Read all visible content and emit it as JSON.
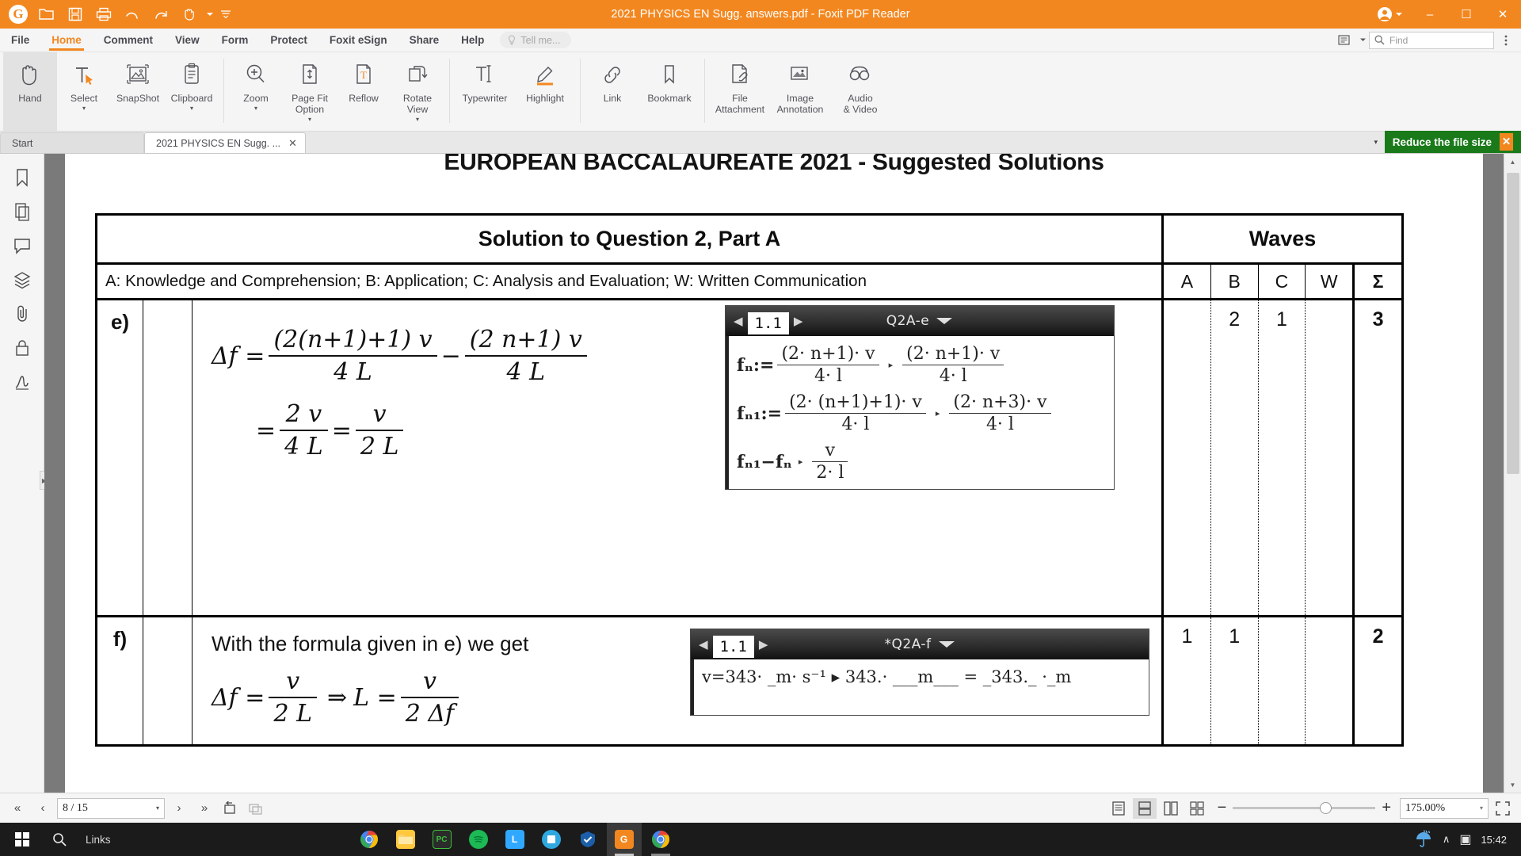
{
  "window": {
    "title": "2021 PHYSICS EN Sugg. answers.pdf - Foxit PDF Reader",
    "brand_color": "#f3871f",
    "logo_glyph": "G",
    "quick_access": [
      {
        "name": "open-icon",
        "tooltip": "Open"
      },
      {
        "name": "save-icon",
        "tooltip": "Save"
      },
      {
        "name": "print-icon",
        "tooltip": "Print"
      },
      {
        "name": "undo-icon",
        "tooltip": "Undo"
      },
      {
        "name": "redo-icon",
        "tooltip": "Redo"
      },
      {
        "name": "hand-tool-icon",
        "tooltip": "Hand Tool"
      },
      {
        "name": "customize-icon",
        "tooltip": "Customize"
      }
    ],
    "controls": {
      "account_label": "",
      "minimize": "–",
      "maximize": "☐",
      "close": "✕"
    }
  },
  "menubar": {
    "items": [
      {
        "label": "File",
        "active": false
      },
      {
        "label": "Home",
        "active": true
      },
      {
        "label": "Comment",
        "active": false
      },
      {
        "label": "View",
        "active": false
      },
      {
        "label": "Form",
        "active": false
      },
      {
        "label": "Protect",
        "active": false
      },
      {
        "label": "Foxit eSign",
        "active": false
      },
      {
        "label": "Share",
        "active": false
      },
      {
        "label": "Help",
        "active": false
      }
    ],
    "tell_me": "Tell me...",
    "find_placeholder": "Find"
  },
  "ribbon": {
    "groups": [
      {
        "items": [
          {
            "label": "Hand",
            "label2": "",
            "icon": "hand-icon",
            "selected": true,
            "caret": false
          },
          {
            "label": "Select",
            "label2": "",
            "icon": "select-text-icon",
            "selected": false,
            "caret": true
          },
          {
            "label": "SnapShot",
            "label2": "",
            "icon": "snapshot-icon",
            "selected": false,
            "caret": false
          },
          {
            "label": "Clipboard",
            "label2": "",
            "icon": "clipboard-icon",
            "selected": false,
            "caret": true
          }
        ]
      },
      {
        "items": [
          {
            "label": "Zoom",
            "label2": "",
            "icon": "zoom-in-icon",
            "selected": false,
            "caret": true
          },
          {
            "label": "Page Fit",
            "label2": "Option",
            "icon": "page-fit-icon",
            "selected": false,
            "caret": true
          },
          {
            "label": "Reflow",
            "label2": "",
            "icon": "reflow-icon",
            "selected": false,
            "caret": false
          },
          {
            "label": "Rotate",
            "label2": "View",
            "icon": "rotate-view-icon",
            "selected": false,
            "caret": true
          }
        ]
      },
      {
        "items": [
          {
            "label": "Typewriter",
            "label2": "",
            "icon": "typewriter-icon",
            "selected": false,
            "caret": false
          },
          {
            "label": "Highlight",
            "label2": "",
            "icon": "highlight-icon",
            "selected": false,
            "caret": false
          }
        ]
      },
      {
        "items": [
          {
            "label": "Link",
            "label2": "",
            "icon": "link-icon",
            "selected": false,
            "caret": false
          },
          {
            "label": "Bookmark",
            "label2": "",
            "icon": "bookmark-icon",
            "selected": false,
            "caret": false
          }
        ]
      },
      {
        "items": [
          {
            "label": "File",
            "label2": "Attachment",
            "icon": "file-attachment-icon",
            "selected": false,
            "caret": false
          },
          {
            "label": "Image",
            "label2": "Annotation",
            "icon": "image-annotation-icon",
            "selected": false,
            "caret": false
          },
          {
            "label": "Audio",
            "label2": "& Video",
            "icon": "audio-video-icon",
            "selected": false,
            "caret": false
          }
        ]
      }
    ]
  },
  "tabstrip": {
    "tabs": [
      {
        "label": "Start",
        "active": false,
        "closable": false
      },
      {
        "label": "2021 PHYSICS EN Sugg. ...",
        "active": true,
        "closable": true
      }
    ],
    "close_glyph": "✕",
    "banner": {
      "label": "Reduce the file size",
      "close_glyph": "✕",
      "color": "#1a7a1a"
    }
  },
  "leftbar": {
    "items": [
      {
        "name": "bookmarks-panel-icon"
      },
      {
        "name": "page-thumbnails-icon"
      },
      {
        "name": "comments-panel-icon"
      },
      {
        "name": "layers-panel-icon"
      },
      {
        "name": "attachments-panel-icon"
      },
      {
        "name": "security-panel-icon"
      },
      {
        "name": "signatures-panel-icon"
      }
    ],
    "expand_glyph": "▶"
  },
  "document": {
    "page_header": "EUROPEAN BACCALAUREATE 2021 - Suggested Solutions",
    "table": {
      "title": "Solution to Question 2, Part A",
      "topic": "Waves",
      "criteria_legend": "A: Knowledge and Comprehension; B: Application; C: Analysis and Evaluation; W: Written Communication",
      "score_headers": [
        "A",
        "B",
        "C",
        "W",
        "Σ"
      ],
      "rows": [
        {
          "letter": "e)",
          "text": "",
          "scores": [
            "",
            "2",
            "1",
            "",
            "3"
          ],
          "calc": {
            "page_number": "1.1",
            "title": "Q2A-e",
            "lines": [
              {
                "lhs": "fₙ:=",
                "num1": "(2· n+1)· v",
                "den1": "4· l",
                "num2": "(2· n+1)· v",
                "den2": "4· l"
              },
              {
                "lhs": "fₙ₁:=",
                "num1": "(2· (n+1)+1)· v",
                "den1": "4· l",
                "num2": "(2· n+3)· v",
                "den2": "4· l"
              },
              {
                "lhs": "fₙ₁−fₙ",
                "num1": "",
                "den1": "",
                "num2": "v",
                "den2": "2· l"
              }
            ]
          }
        },
        {
          "letter": "f)",
          "text": "With the formula given in e) we get",
          "scores": [
            "1",
            "1",
            "",
            "",
            "2"
          ],
          "calc": {
            "page_number": "1.1",
            "title": "*Q2A-f",
            "expr": "v=343· _m· s⁻¹  ▸  343.· ___m___ = _343._ ·_m"
          }
        }
      ]
    },
    "formulas": {
      "e_line1_lhs": "Δf =",
      "e_line1_num1": "(2(n+1)+1) v",
      "e_line1_den1": "4 L",
      "e_line1_op": "−",
      "e_line1_num2": "(2 n+1) v",
      "e_line1_den2": "4 L",
      "e_line2_eq": "=",
      "e_line2_num1": "2 v",
      "e_line2_den1": "4 L",
      "e_line2_eq2": "=",
      "e_line2_num2": "v",
      "e_line2_den2": "2 L",
      "f_lhs": "Δf =",
      "f_num1": "v",
      "f_den1": "2 L",
      "f_implies": "⇒",
      "f_mid": "L =",
      "f_num2": "v",
      "f_den2": "2 Δf"
    }
  },
  "statusbar": {
    "nav": {
      "first": "«",
      "prev": "‹",
      "page_value": "8 / 15",
      "next": "›",
      "last": "»"
    },
    "extra_buttons": [
      {
        "name": "previous-view-icon"
      },
      {
        "name": "next-view-icon"
      }
    ],
    "view_modes": [
      {
        "name": "single-page-icon",
        "selected": false
      },
      {
        "name": "continuous-icon",
        "selected": true
      },
      {
        "name": "two-page-icon",
        "selected": false
      },
      {
        "name": "two-page-continuous-icon",
        "selected": false
      }
    ],
    "zoom_out": "−",
    "zoom_in": "+",
    "zoom_value": "175.00%",
    "fullscreen": "fullscreen-icon"
  },
  "taskbar": {
    "start": "start-icon",
    "search": "search-icon",
    "links_label": "Links",
    "apps": [
      {
        "name": "chrome-icon",
        "glyph": "",
        "color": "#4285f4",
        "running": false,
        "active": false
      },
      {
        "name": "file-explorer-icon",
        "glyph": "",
        "color": "#ffc83d",
        "running": false,
        "active": false
      },
      {
        "name": "calculator-icon",
        "glyph": "",
        "color": "#3ac13a",
        "running": false,
        "active": false
      },
      {
        "name": "spotify-icon",
        "glyph": "",
        "color": "#1db954",
        "running": false,
        "active": false
      },
      {
        "name": "lightroom-icon",
        "glyph": "L",
        "color": "#31a8ff",
        "running": false,
        "active": false
      },
      {
        "name": "app6-icon",
        "glyph": "",
        "color": "#2fa8e0",
        "running": false,
        "active": false
      },
      {
        "name": "app7-icon",
        "glyph": "✔",
        "color": "#1c5fa8",
        "running": false,
        "active": false
      },
      {
        "name": "foxit-reader-icon",
        "glyph": "G",
        "color": "#f3871f",
        "running": true,
        "active": true
      },
      {
        "name": "chrome-2-icon",
        "glyph": "",
        "color": "#4285f4",
        "running": true,
        "active": false
      }
    ],
    "tray": {
      "weather_icon": "umbrella-icon",
      "chevron": "∧",
      "battery": "▣",
      "time": "15:42"
    }
  }
}
